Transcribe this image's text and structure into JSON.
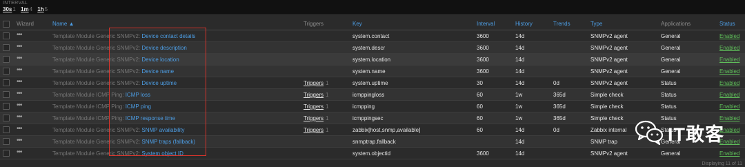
{
  "filter": {
    "interval_title": "INTERVAL",
    "intervals": [
      {
        "label": "30s",
        "count": "1"
      },
      {
        "label": "1m",
        "count": "4"
      },
      {
        "label": "1h",
        "count": "5"
      }
    ]
  },
  "table": {
    "headers": {
      "wizard": "Wizard",
      "name": "Name ▲",
      "triggers": "Triggers",
      "key": "Key",
      "interval": "Interval",
      "history": "History",
      "trends": "Trends",
      "type": "Type",
      "applications": "Applications",
      "status": "Status"
    },
    "rows": [
      {
        "template": "Template Module Generic SNMPv2:",
        "item": "Device contact details",
        "triggers": "",
        "trigger_count": "",
        "key": "system.contact",
        "interval": "3600",
        "history": "14d",
        "trends": "",
        "type": "SNMPv2 agent",
        "applications": "General",
        "status": "Enabled"
      },
      {
        "template": "Template Module Generic SNMPv2:",
        "item": "Device description",
        "triggers": "",
        "trigger_count": "",
        "key": "system.descr",
        "interval": "3600",
        "history": "14d",
        "trends": "",
        "type": "SNMPv2 agent",
        "applications": "General",
        "status": "Enabled"
      },
      {
        "template": "Template Module Generic SNMPv2:",
        "item": "Device location",
        "triggers": "",
        "trigger_count": "",
        "key": "system.location",
        "interval": "3600",
        "history": "14d",
        "trends": "",
        "type": "SNMPv2 agent",
        "applications": "General",
        "status": "Enabled"
      },
      {
        "template": "Template Module Generic SNMPv2:",
        "item": "Device name",
        "triggers": "",
        "trigger_count": "",
        "key": "system.name",
        "interval": "3600",
        "history": "14d",
        "trends": "",
        "type": "SNMPv2 agent",
        "applications": "General",
        "status": "Enabled"
      },
      {
        "template": "Template Module Generic SNMPv2:",
        "item": "Device uptime",
        "triggers": "Triggers",
        "trigger_count": "1",
        "key": "system.uptime",
        "interval": "30",
        "history": "14d",
        "trends": "0d",
        "type": "SNMPv2 agent",
        "applications": "Status",
        "status": "Enabled"
      },
      {
        "template": "Template Module ICMP Ping:",
        "item": "ICMP loss",
        "triggers": "Triggers",
        "trigger_count": "1",
        "key": "icmppingloss",
        "interval": "60",
        "history": "1w",
        "trends": "365d",
        "type": "Simple check",
        "applications": "Status",
        "status": "Enabled"
      },
      {
        "template": "Template Module ICMP Ping:",
        "item": "ICMP ping",
        "triggers": "Triggers",
        "trigger_count": "1",
        "key": "icmpping",
        "interval": "60",
        "history": "1w",
        "trends": "365d",
        "type": "Simple check",
        "applications": "Status",
        "status": "Enabled"
      },
      {
        "template": "Template Module ICMP Ping:",
        "item": "ICMP response time",
        "triggers": "Triggers",
        "trigger_count": "1",
        "key": "icmppingsec",
        "interval": "60",
        "history": "1w",
        "trends": "365d",
        "type": "Simple check",
        "applications": "Status",
        "status": "Enabled"
      },
      {
        "template": "Template Module Generic SNMPv2:",
        "item": "SNMP availability",
        "triggers": "Triggers",
        "trigger_count": "1",
        "key": "zabbix[host,snmp,available]",
        "interval": "60",
        "history": "14d",
        "trends": "0d",
        "type": "Zabbix internal",
        "applications": "Status",
        "status": "Enabled"
      },
      {
        "template": "Template Module Generic SNMPv2:",
        "item": "SNMP traps (fallback)",
        "triggers": "",
        "trigger_count": "",
        "key": "snmptrap.fallback",
        "interval": "",
        "history": "14d",
        "trends": "",
        "type": "SNMP trap",
        "applications": "General",
        "status": "Enabled"
      },
      {
        "template": "Template Module Generic SNMPv2:",
        "item": "System object ID",
        "triggers": "",
        "trigger_count": "",
        "key": "system.objectid",
        "interval": "3600",
        "history": "14d",
        "trends": "",
        "type": "SNMPv2 agent",
        "applications": "General",
        "status": "Enabled"
      }
    ]
  },
  "footer": {
    "text": "Displaying 11 of 11"
  },
  "watermark": {
    "text": "IT敢客",
    "icon": "wechat-logo-icon"
  },
  "colors": {
    "accent": "#4d9ee5",
    "enabled": "#5fc05a",
    "highlight": "#d9342b",
    "background": "#2b2b2b"
  }
}
